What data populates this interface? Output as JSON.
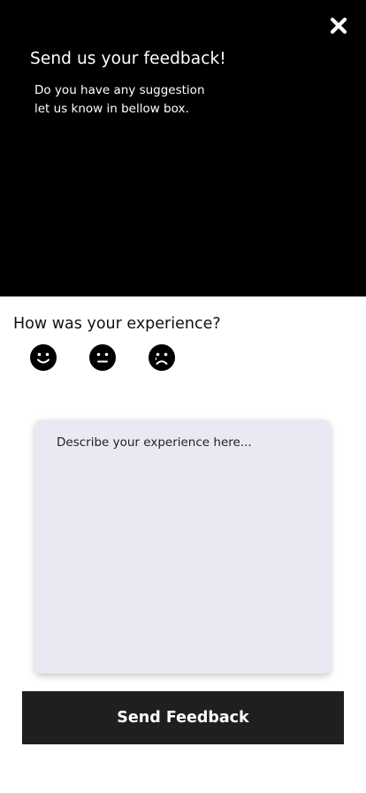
{
  "header": {
    "title": "Send us your feedback!",
    "subtitle_line1": "Do you have any suggestion",
    "subtitle_line2": "let us know in bellow box.",
    "close_icon": "close-icon",
    "background_color": "#000000"
  },
  "rating": {
    "question": "How was your experience?",
    "options": [
      {
        "icon": "happy-face-icon"
      },
      {
        "icon": "neutral-face-icon"
      },
      {
        "icon": "sad-face-icon"
      }
    ]
  },
  "feedback": {
    "placeholder": "Describe your experience here...",
    "box_color": "#e9e9f3"
  },
  "actions": {
    "send_label": "Send Feedback",
    "button_color": "#1f1f1f"
  }
}
